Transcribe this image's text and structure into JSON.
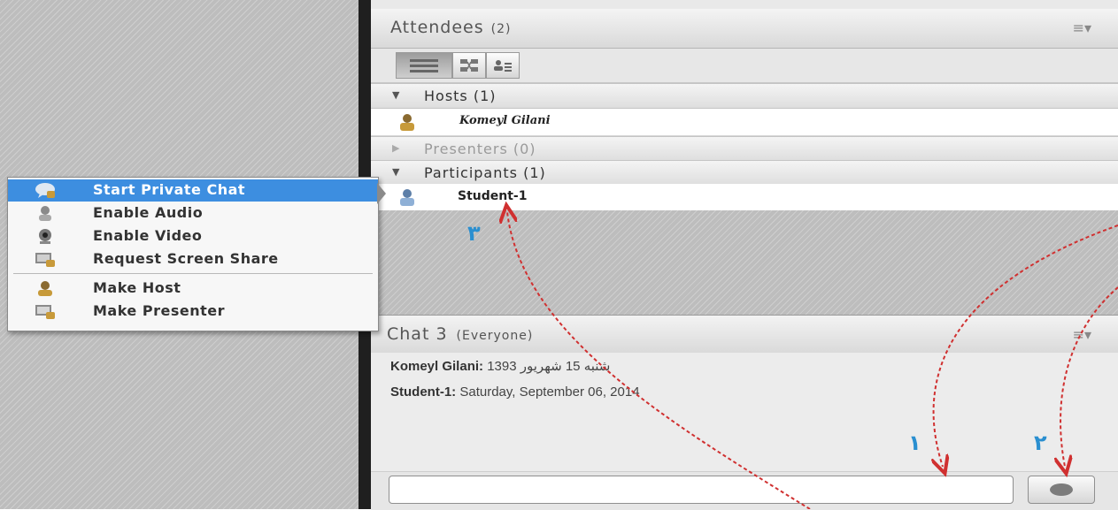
{
  "attendees": {
    "title": "Attendees",
    "count": "(2)",
    "menu_icon": "list-menu-icon",
    "views": [
      "list-view-icon",
      "grid-view-icon",
      "user-list-view-icon"
    ],
    "groups": {
      "hosts": {
        "label": "Hosts (1)",
        "expanded": true
      },
      "presenters": {
        "label": "Presenters (0)",
        "expanded": false
      },
      "participants": {
        "label": "Participants (1)",
        "expanded": true
      }
    },
    "hosts": [
      {
        "name": "Komeyl Gilani"
      }
    ],
    "participants": [
      {
        "name": "Student-1"
      }
    ]
  },
  "context_menu": {
    "items": [
      {
        "label": "Start Private Chat",
        "icon": "chat-bubble-icon",
        "highlighted": true
      },
      {
        "label": "Enable Audio",
        "icon": "microphone-icon"
      },
      {
        "label": "Enable Video",
        "icon": "webcam-icon"
      },
      {
        "label": "Request Screen Share",
        "icon": "screen-share-icon"
      },
      {
        "label": "Make Host",
        "icon": "host-icon"
      },
      {
        "label": "Make Presenter",
        "icon": "presenter-icon"
      }
    ]
  },
  "chat": {
    "title": "Chat 3",
    "scope": "(Everyone)",
    "messages": [
      {
        "sender": "Komeyl Gilani:",
        "text": "1393 شنبه 15 شهریور"
      },
      {
        "sender": "Student-1:",
        "text": "Saturday, September 06, 2014"
      }
    ],
    "input_value": ""
  },
  "annotations": {
    "labels": [
      "۱",
      "۲",
      "۳"
    ],
    "arrow_color": "#d03030",
    "label_color": "#2a8fd0"
  }
}
